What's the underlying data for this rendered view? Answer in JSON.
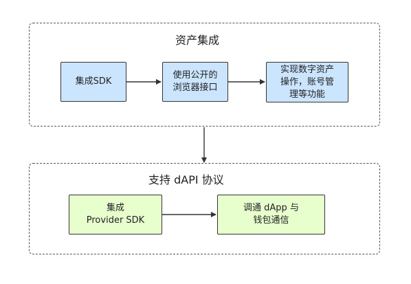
{
  "groups": {
    "asset": {
      "title": "资产集成"
    },
    "dapi": {
      "title": "支持 dAPI 协议"
    }
  },
  "nodes": {
    "sdk": {
      "lines": [
        "集成SDK"
      ]
    },
    "browser_api": {
      "lines": [
        "使用公开的",
        "浏览器接口"
      ]
    },
    "asset_ops": {
      "lines": [
        "实现数字资产",
        "操作，账号管",
        "理等功能"
      ]
    },
    "provider_sdk": {
      "lines": [
        "集成",
        "Provider SDK"
      ]
    },
    "dapp_comm": {
      "lines": [
        "调通 dApp 与",
        "钱包通信"
      ]
    }
  },
  "colors": {
    "blue_fill": "#cce5ff",
    "green_fill": "#e6ffcc",
    "stroke": "#333333",
    "group_border": "#555555"
  }
}
